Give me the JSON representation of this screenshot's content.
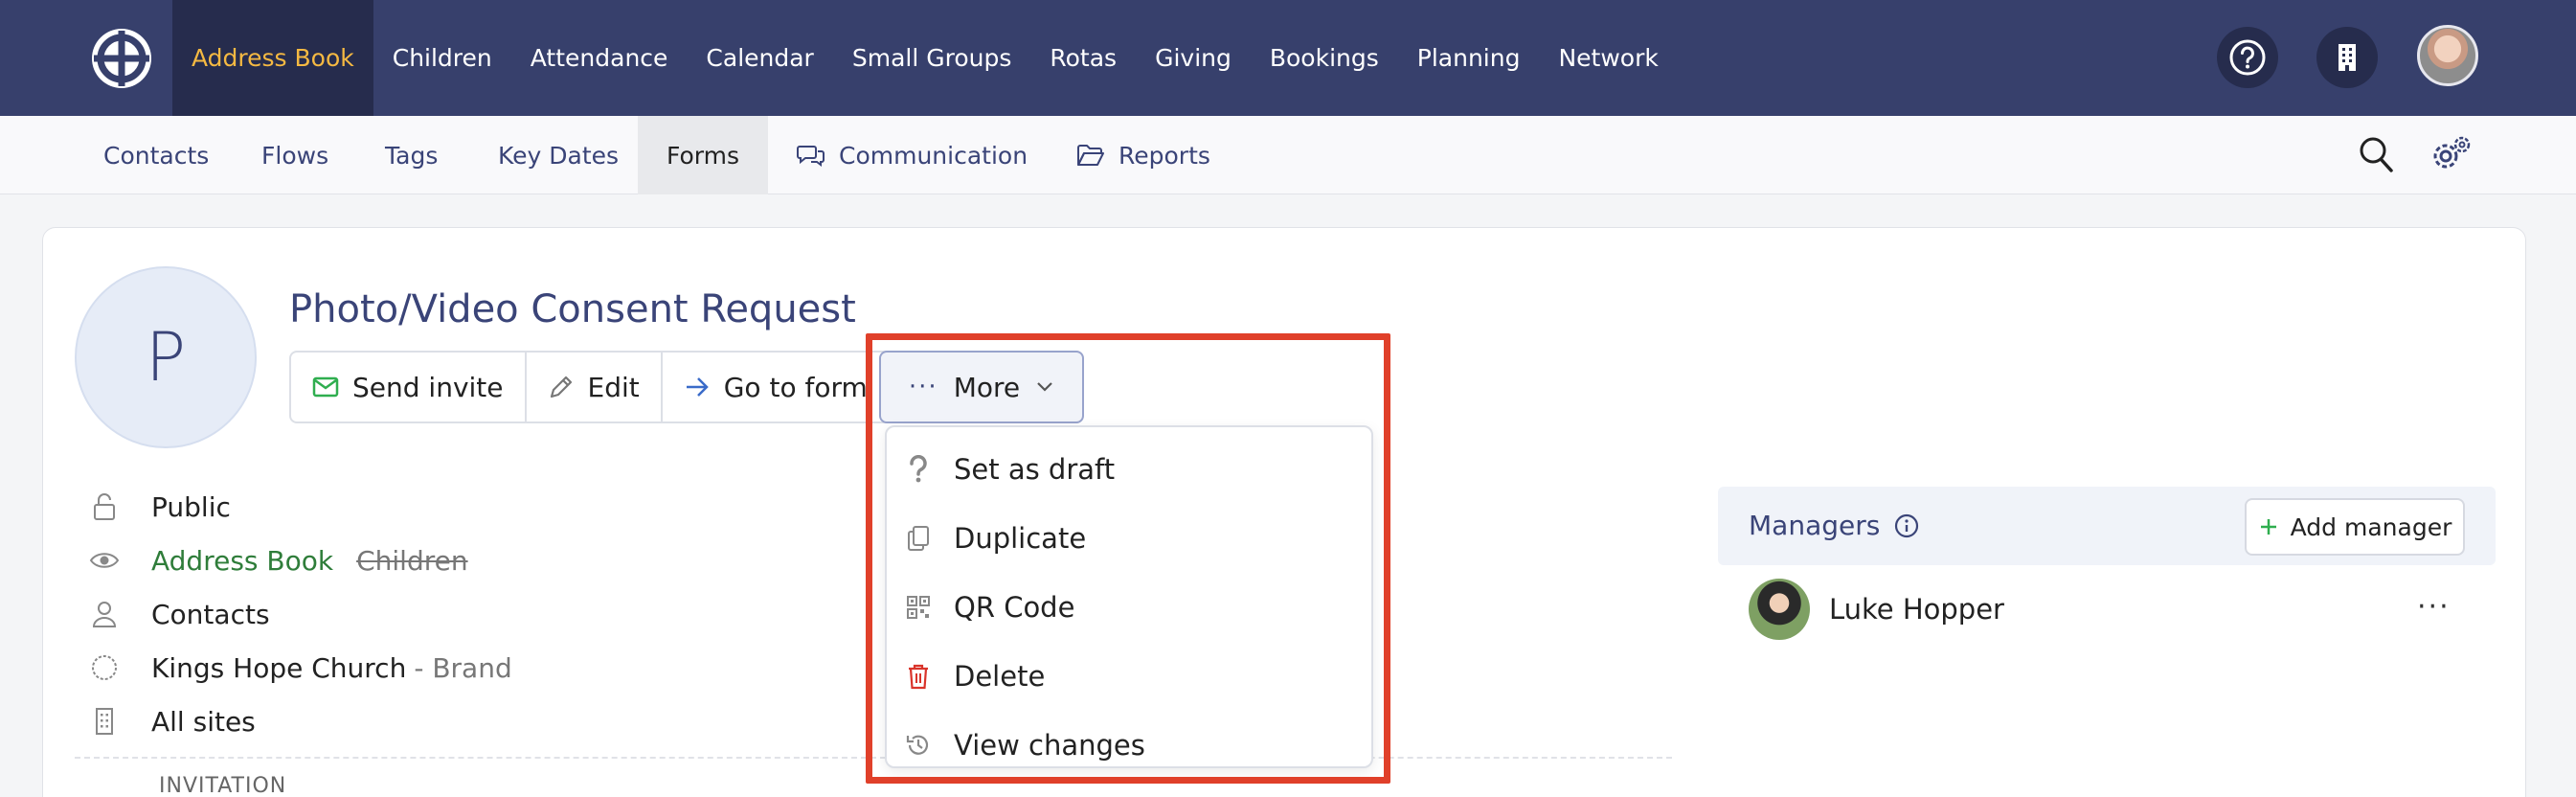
{
  "topnav": {
    "items": [
      {
        "label": "Address Book",
        "active": true
      },
      {
        "label": "Children"
      },
      {
        "label": "Attendance"
      },
      {
        "label": "Calendar"
      },
      {
        "label": "Small Groups"
      },
      {
        "label": "Rotas"
      },
      {
        "label": "Giving"
      },
      {
        "label": "Bookings"
      },
      {
        "label": "Planning"
      },
      {
        "label": "Network"
      }
    ]
  },
  "subnav": {
    "items": [
      {
        "label": "Contacts"
      },
      {
        "label": "Flows"
      },
      {
        "label": "Tags"
      },
      {
        "label": "Key Dates"
      },
      {
        "label": "Forms",
        "active": true
      },
      {
        "label": "Communication"
      },
      {
        "label": "Reports"
      }
    ]
  },
  "form": {
    "avatar_letter": "P",
    "title": "Photo/Video Consent Request",
    "buttons": {
      "send_invite": "Send invite",
      "edit": "Edit",
      "go_to_form": "Go to form",
      "more": "More"
    }
  },
  "meta": {
    "visibility": "Public",
    "modules_active": "Address Book",
    "modules_struck": "Children",
    "audience": "Contacts",
    "brand_name": "Kings Hope Church",
    "brand_suffix": "- Brand",
    "sites": "All sites",
    "section_heading": "INVITATION"
  },
  "dropdown": {
    "items": [
      {
        "label": "Set as draft",
        "icon": "question-icon"
      },
      {
        "label": "Duplicate",
        "icon": "duplicate-icon"
      },
      {
        "label": "QR Code",
        "icon": "qr-code-icon"
      },
      {
        "label": "Delete",
        "icon": "trash-icon"
      },
      {
        "label": "View changes",
        "icon": "history-icon"
      }
    ]
  },
  "managers": {
    "heading": "Managers",
    "add_label": "Add manager",
    "people": [
      {
        "name": "Luke Hopper"
      }
    ],
    "more_glyph": "···"
  },
  "colors": {
    "nav_bg": "#37406c",
    "nav_active_bg": "#262c4d",
    "nav_active_text": "#f5b942",
    "accent": "#3a4478",
    "success": "#2fae4f",
    "danger": "#d9342b",
    "highlight": "#e0402a"
  }
}
